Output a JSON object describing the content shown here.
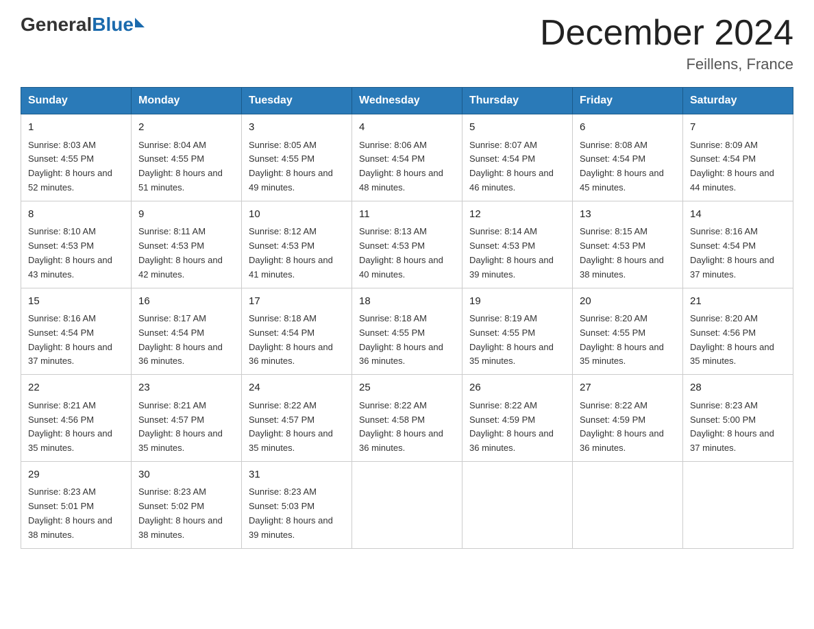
{
  "logo": {
    "general": "General",
    "blue": "Blue"
  },
  "title": "December 2024",
  "location": "Feillens, France",
  "days_header": [
    "Sunday",
    "Monday",
    "Tuesday",
    "Wednesday",
    "Thursday",
    "Friday",
    "Saturday"
  ],
  "weeks": [
    [
      {
        "day": "1",
        "sunrise": "8:03 AM",
        "sunset": "4:55 PM",
        "daylight": "8 hours and 52 minutes."
      },
      {
        "day": "2",
        "sunrise": "8:04 AM",
        "sunset": "4:55 PM",
        "daylight": "8 hours and 51 minutes."
      },
      {
        "day": "3",
        "sunrise": "8:05 AM",
        "sunset": "4:55 PM",
        "daylight": "8 hours and 49 minutes."
      },
      {
        "day": "4",
        "sunrise": "8:06 AM",
        "sunset": "4:54 PM",
        "daylight": "8 hours and 48 minutes."
      },
      {
        "day": "5",
        "sunrise": "8:07 AM",
        "sunset": "4:54 PM",
        "daylight": "8 hours and 46 minutes."
      },
      {
        "day": "6",
        "sunrise": "8:08 AM",
        "sunset": "4:54 PM",
        "daylight": "8 hours and 45 minutes."
      },
      {
        "day": "7",
        "sunrise": "8:09 AM",
        "sunset": "4:54 PM",
        "daylight": "8 hours and 44 minutes."
      }
    ],
    [
      {
        "day": "8",
        "sunrise": "8:10 AM",
        "sunset": "4:53 PM",
        "daylight": "8 hours and 43 minutes."
      },
      {
        "day": "9",
        "sunrise": "8:11 AM",
        "sunset": "4:53 PM",
        "daylight": "8 hours and 42 minutes."
      },
      {
        "day": "10",
        "sunrise": "8:12 AM",
        "sunset": "4:53 PM",
        "daylight": "8 hours and 41 minutes."
      },
      {
        "day": "11",
        "sunrise": "8:13 AM",
        "sunset": "4:53 PM",
        "daylight": "8 hours and 40 minutes."
      },
      {
        "day": "12",
        "sunrise": "8:14 AM",
        "sunset": "4:53 PM",
        "daylight": "8 hours and 39 minutes."
      },
      {
        "day": "13",
        "sunrise": "8:15 AM",
        "sunset": "4:53 PM",
        "daylight": "8 hours and 38 minutes."
      },
      {
        "day": "14",
        "sunrise": "8:16 AM",
        "sunset": "4:54 PM",
        "daylight": "8 hours and 37 minutes."
      }
    ],
    [
      {
        "day": "15",
        "sunrise": "8:16 AM",
        "sunset": "4:54 PM",
        "daylight": "8 hours and 37 minutes."
      },
      {
        "day": "16",
        "sunrise": "8:17 AM",
        "sunset": "4:54 PM",
        "daylight": "8 hours and 36 minutes."
      },
      {
        "day": "17",
        "sunrise": "8:18 AM",
        "sunset": "4:54 PM",
        "daylight": "8 hours and 36 minutes."
      },
      {
        "day": "18",
        "sunrise": "8:18 AM",
        "sunset": "4:55 PM",
        "daylight": "8 hours and 36 minutes."
      },
      {
        "day": "19",
        "sunrise": "8:19 AM",
        "sunset": "4:55 PM",
        "daylight": "8 hours and 35 minutes."
      },
      {
        "day": "20",
        "sunrise": "8:20 AM",
        "sunset": "4:55 PM",
        "daylight": "8 hours and 35 minutes."
      },
      {
        "day": "21",
        "sunrise": "8:20 AM",
        "sunset": "4:56 PM",
        "daylight": "8 hours and 35 minutes."
      }
    ],
    [
      {
        "day": "22",
        "sunrise": "8:21 AM",
        "sunset": "4:56 PM",
        "daylight": "8 hours and 35 minutes."
      },
      {
        "day": "23",
        "sunrise": "8:21 AM",
        "sunset": "4:57 PM",
        "daylight": "8 hours and 35 minutes."
      },
      {
        "day": "24",
        "sunrise": "8:22 AM",
        "sunset": "4:57 PM",
        "daylight": "8 hours and 35 minutes."
      },
      {
        "day": "25",
        "sunrise": "8:22 AM",
        "sunset": "4:58 PM",
        "daylight": "8 hours and 36 minutes."
      },
      {
        "day": "26",
        "sunrise": "8:22 AM",
        "sunset": "4:59 PM",
        "daylight": "8 hours and 36 minutes."
      },
      {
        "day": "27",
        "sunrise": "8:22 AM",
        "sunset": "4:59 PM",
        "daylight": "8 hours and 36 minutes."
      },
      {
        "day": "28",
        "sunrise": "8:23 AM",
        "sunset": "5:00 PM",
        "daylight": "8 hours and 37 minutes."
      }
    ],
    [
      {
        "day": "29",
        "sunrise": "8:23 AM",
        "sunset": "5:01 PM",
        "daylight": "8 hours and 38 minutes."
      },
      {
        "day": "30",
        "sunrise": "8:23 AM",
        "sunset": "5:02 PM",
        "daylight": "8 hours and 38 minutes."
      },
      {
        "day": "31",
        "sunrise": "8:23 AM",
        "sunset": "5:03 PM",
        "daylight": "8 hours and 39 minutes."
      },
      null,
      null,
      null,
      null
    ]
  ]
}
